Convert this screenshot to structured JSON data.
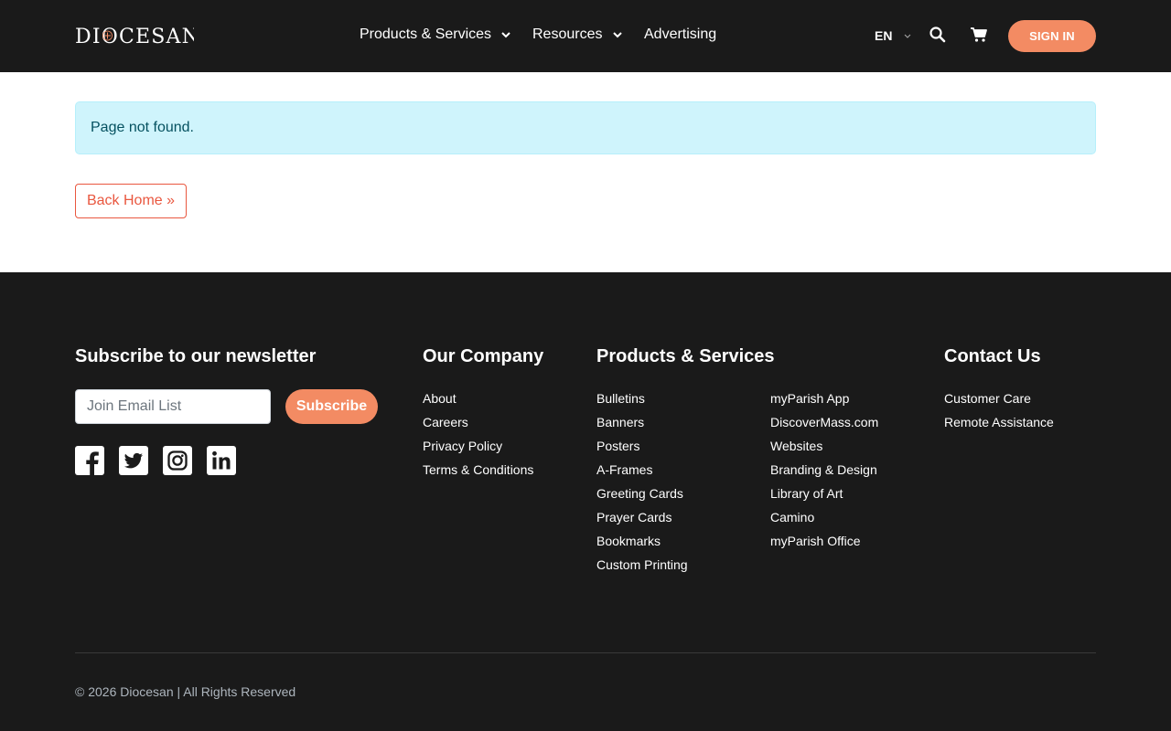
{
  "header": {
    "logo_text": "DIOCESAN",
    "nav": [
      {
        "label": "Products & Services",
        "has_dropdown": true
      },
      {
        "label": "Resources",
        "has_dropdown": true
      },
      {
        "label": "Advertising",
        "has_dropdown": false
      }
    ],
    "language": "EN",
    "search_icon": "search-icon",
    "cart_icon": "cart-icon",
    "signin_label": "SIGN IN",
    "accent_color": "#f38b63"
  },
  "main": {
    "alert_text": "Page not found.",
    "back_home_label": "Back Home »"
  },
  "footer": {
    "newsletter": {
      "heading": "Subscribe to our newsletter",
      "input_placeholder": "Join Email List",
      "subscribe_label": "Subscribe"
    },
    "social_icons": [
      "facebook-icon",
      "twitter-icon",
      "instagram-icon",
      "linkedin-icon"
    ],
    "company": {
      "heading": "Our Company",
      "links": [
        "About",
        "Careers",
        "Privacy Policy",
        "Terms & Conditions"
      ]
    },
    "products": {
      "heading": "Products & Services",
      "links_col1": [
        "Bulletins",
        "Banners",
        "Posters",
        "A-Frames",
        "Greeting Cards",
        "Prayer Cards",
        "Bookmarks",
        "Custom Printing"
      ],
      "links_col2": [
        "myParish App",
        "DiscoverMass.com",
        "Websites",
        "Branding & Design",
        "Library of Art",
        "Camino",
        "myParish Office"
      ]
    },
    "contact": {
      "heading": "Contact Us",
      "links": [
        "Customer Care",
        "Remote Assistance"
      ]
    },
    "copyright": "© 2026 Diocesan | All Rights Reserved"
  }
}
